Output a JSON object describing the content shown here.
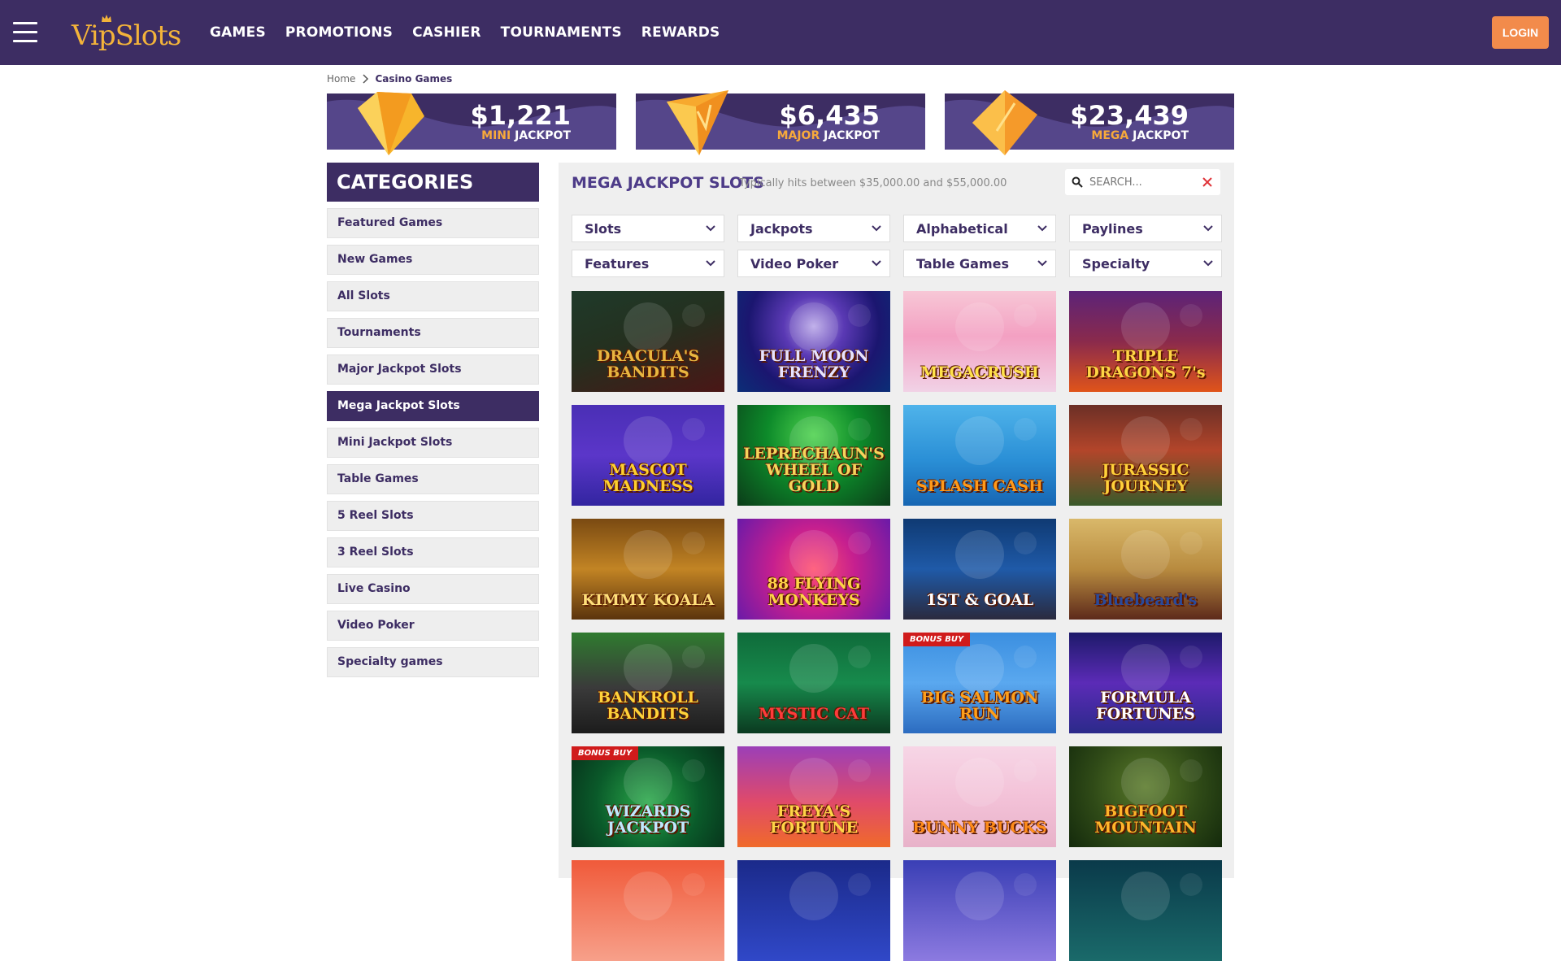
{
  "header": {
    "logo_text": "VipSlots",
    "nav": [
      "GAMES",
      "PROMOTIONS",
      "CASHIER",
      "TOURNAMENTS",
      "REWARDS"
    ],
    "login_label": "LOGIN"
  },
  "breadcrumb": {
    "home": "Home",
    "current": "Casino Games"
  },
  "jackpots": [
    {
      "amount": "$1,221",
      "tier": "MINI",
      "suffix": "JACKPOT",
      "gem_color": "#f7b52c"
    },
    {
      "amount": "$6,435",
      "tier": "MAJOR",
      "suffix": "JACKPOT",
      "gem_color": "#f7a92e"
    },
    {
      "amount": "$23,439",
      "tier": "MEGA",
      "suffix": "JACKPOT",
      "gem_color": "#f59a2a"
    }
  ],
  "sidebar": {
    "title": "CATEGORIES",
    "items": [
      {
        "label": "Featured Games",
        "active": false
      },
      {
        "label": "New Games",
        "active": false
      },
      {
        "label": "All Slots",
        "active": false
      },
      {
        "label": "Tournaments",
        "active": false
      },
      {
        "label": "Major Jackpot Slots",
        "active": false
      },
      {
        "label": "Mega Jackpot Slots",
        "active": true
      },
      {
        "label": "Mini Jackpot Slots",
        "active": false
      },
      {
        "label": "Table Games",
        "active": false
      },
      {
        "label": "5 Reel Slots",
        "active": false
      },
      {
        "label": "3 Reel Slots",
        "active": false
      },
      {
        "label": "Live Casino",
        "active": false
      },
      {
        "label": "Video Poker",
        "active": false
      },
      {
        "label": "Specialty games",
        "active": false
      }
    ]
  },
  "main": {
    "title": "MEGA JACKPOT SLOTS",
    "subtitle": "Typically hits between $35,000.00 and $55,000.00",
    "search": {
      "placeholder": "SEARCH...",
      "value": ""
    },
    "filters": [
      "Slots",
      "Jackpots",
      "Alphabetical",
      "Paylines",
      "Features",
      "Video Poker",
      "Table Games",
      "Specialty"
    ],
    "games": [
      {
        "title": "DRACULA'S BANDITS",
        "badge": "",
        "bg": "linear-gradient(160deg,#1f3a2a 0%,#24301f 45%,#4a1616 100%)",
        "color": "#e8b640"
      },
      {
        "title": "FULL MOON FRENZY",
        "badge": "",
        "bg": "radial-gradient(circle at 50% 35%,#b9a7e8 0%,#5a39b4 30%,#1b1670 65%,#0b2e77 100%)",
        "color": "#e7e3ff"
      },
      {
        "title": "MEGACRUSH",
        "badge": "",
        "bg": "linear-gradient(180deg,#f7c7d6 0%,#f3a0c2 45%,#f1d2e6 100%)",
        "color": "#ffe24a"
      },
      {
        "title": "TRIPLE DRAGONS 7's",
        "badge": "",
        "bg": "linear-gradient(180deg,#5c2378 0%,#8a2a4c 50%,#e0541a 100%)",
        "color": "#ffd545"
      },
      {
        "title": "MASCOT MADNESS",
        "badge": "",
        "bg": "linear-gradient(180deg,#4a2fb5 0%,#5b36c9 50%,#3225a0 100%)",
        "color": "#ffcf2f"
      },
      {
        "title": "LEPRECHAUN'S WHEEL OF GOLD",
        "badge": "",
        "bg": "radial-gradient(circle at 50% 30%,#4ed24e 0%,#0d8a2a 45%,#0b3c19 100%)",
        "color": "#f7d45c"
      },
      {
        "title": "SPLASH CASH",
        "badge": "",
        "bg": "linear-gradient(180deg,#4fb3ea 0%,#2a8fd6 55%,#1766b3 100%)",
        "color": "#ff9a1a"
      },
      {
        "title": "JURASSIC JOURNEY",
        "badge": "",
        "bg": "linear-gradient(180deg,#6b2f26 0%,#b3452a 45%,#3a5a2a 100%)",
        "color": "#ffd13a"
      },
      {
        "title": "KIMMY KOALA",
        "badge": "",
        "bg": "linear-gradient(180deg,#7a4a12 0%,#c28424 50%,#5b340c 100%)",
        "color": "#ffe07a"
      },
      {
        "title": "88 FLYING MONKEYS",
        "badge": "",
        "bg": "radial-gradient(circle at 50% 50%,#ff4f6f 0%,#c61f8f 45%,#6a1aa8 100%)",
        "color": "#ffd447"
      },
      {
        "title": "1ST & GOAL",
        "badge": "",
        "bg": "linear-gradient(180deg,#0f3a73 0%,#1f5aa8 50%,#2a2a3e 100%)",
        "color": "#ffffff"
      },
      {
        "title": "Bluebeard's",
        "badge": "",
        "bg": "linear-gradient(180deg,#d9b86a 0%,#b88b3f 50%,#5d2a1b 100%)",
        "color": "#2b4a9a"
      },
      {
        "title": "BANKROLL BANDITS",
        "badge": "",
        "bg": "linear-gradient(180deg,#2f7b2f 0%,#3a3a3a 55%,#1c1c1c 100%)",
        "color": "#ffd23a"
      },
      {
        "title": "MYSTIC CAT",
        "badge": "",
        "bg": "linear-gradient(180deg,#0f6b3a 0%,#178a4c 50%,#0b3a20 100%)",
        "color": "#ff3b3b"
      },
      {
        "title": "BIG SALMON RUN",
        "badge": "BONUS BUY",
        "bg": "linear-gradient(180deg,#3b8fe0 0%,#5aa8ef 50%,#2c6cc0 100%)",
        "color": "#ff9f1a"
      },
      {
        "title": "FORMULA FORTUNES",
        "badge": "",
        "bg": "linear-gradient(180deg,#1d1a6a 0%,#5b2bb7 50%,#2b2a8a 100%)",
        "color": "#ffffff"
      },
      {
        "title": "WIZARDS JACKPOT",
        "badge": "BONUS BUY",
        "bg": "radial-gradient(circle at 50% 55%,#2aa84a 0%,#0a5a2a 55%,#07301a 100%)",
        "color": "#bfe9ff"
      },
      {
        "title": "FREYA'S FORTUNE",
        "badge": "",
        "bg": "linear-gradient(180deg,#9b3fb8 0%,#e04a6a 55%,#f06a2a 100%)",
        "color": "#ffd447"
      },
      {
        "title": "BUNNY BUCKS",
        "badge": "",
        "bg": "linear-gradient(180deg,#f7d6e6 0%,#f3c2d8 50%,#e8b2c9 100%)",
        "color": "#ff8c1a"
      },
      {
        "title": "BIGFOOT MOUNTAIN",
        "badge": "",
        "bg": "radial-gradient(circle at 50% 40%,#5a7a2a 0%,#2f4a17 55%,#142a0c 100%)",
        "color": "#ffb52a"
      },
      {
        "title": "",
        "badge": "",
        "bg": "linear-gradient(180deg,#f05a3a 0%,#f7a08a 100%)",
        "color": "#ffffff"
      },
      {
        "title": "",
        "badge": "",
        "bg": "linear-gradient(180deg,#1b2a8a 0%,#3048c8 100%)",
        "color": "#ffffff"
      },
      {
        "title": "",
        "badge": "",
        "bg": "linear-gradient(180deg,#3a3fb5 0%,#8c7ae0 100%)",
        "color": "#ffffff"
      },
      {
        "title": "",
        "badge": "",
        "bg": "linear-gradient(180deg,#0a3a4a 0%,#1a6a6a 100%)",
        "color": "#ffffff"
      }
    ]
  }
}
